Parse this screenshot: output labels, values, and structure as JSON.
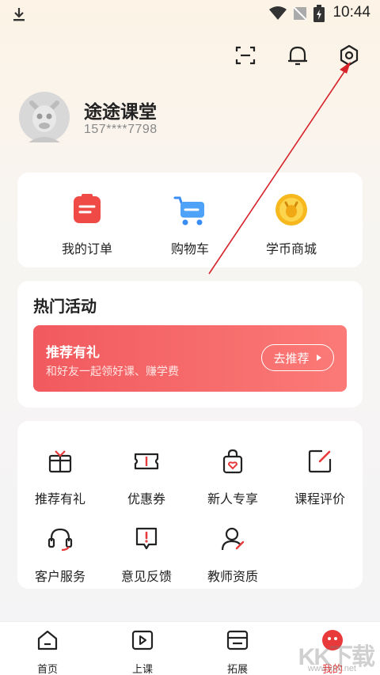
{
  "status": {
    "time": "10:44"
  },
  "profile": {
    "name": "途途课堂",
    "phone": "157****7798"
  },
  "quick_actions": [
    {
      "label": "我的订单",
      "icon": "order-icon"
    },
    {
      "label": "购物车",
      "icon": "cart-icon"
    },
    {
      "label": "学币商城",
      "icon": "coin-mall-icon"
    }
  ],
  "hot_activity": {
    "title": "热门活动",
    "banner": {
      "title": "推荐有礼",
      "subtitle": "和好友一起领好课、赚学费",
      "button": "去推荐"
    }
  },
  "services": [
    {
      "label": "推荐有礼",
      "icon": "gift-icon"
    },
    {
      "label": "优惠券",
      "icon": "coupon-icon"
    },
    {
      "label": "新人专享",
      "icon": "newcomer-bag-icon"
    },
    {
      "label": "课程评价",
      "icon": "edit-icon"
    },
    {
      "label": "客户服务",
      "icon": "headset-icon"
    },
    {
      "label": "意见反馈",
      "icon": "feedback-icon"
    },
    {
      "label": "教师资质",
      "icon": "teacher-icon"
    }
  ],
  "tabs": [
    {
      "label": "首页",
      "icon": "home-icon"
    },
    {
      "label": "上课",
      "icon": "play-icon"
    },
    {
      "label": "拓展",
      "icon": "expand-icon"
    },
    {
      "label": "我的",
      "icon": "me-icon",
      "active": true
    }
  ],
  "watermark": {
    "text": "KK下载",
    "url": "www.kkx.net"
  },
  "colors": {
    "accent": "#e8393b",
    "banner": "#f15a5f",
    "arrow": "#d6232a"
  }
}
